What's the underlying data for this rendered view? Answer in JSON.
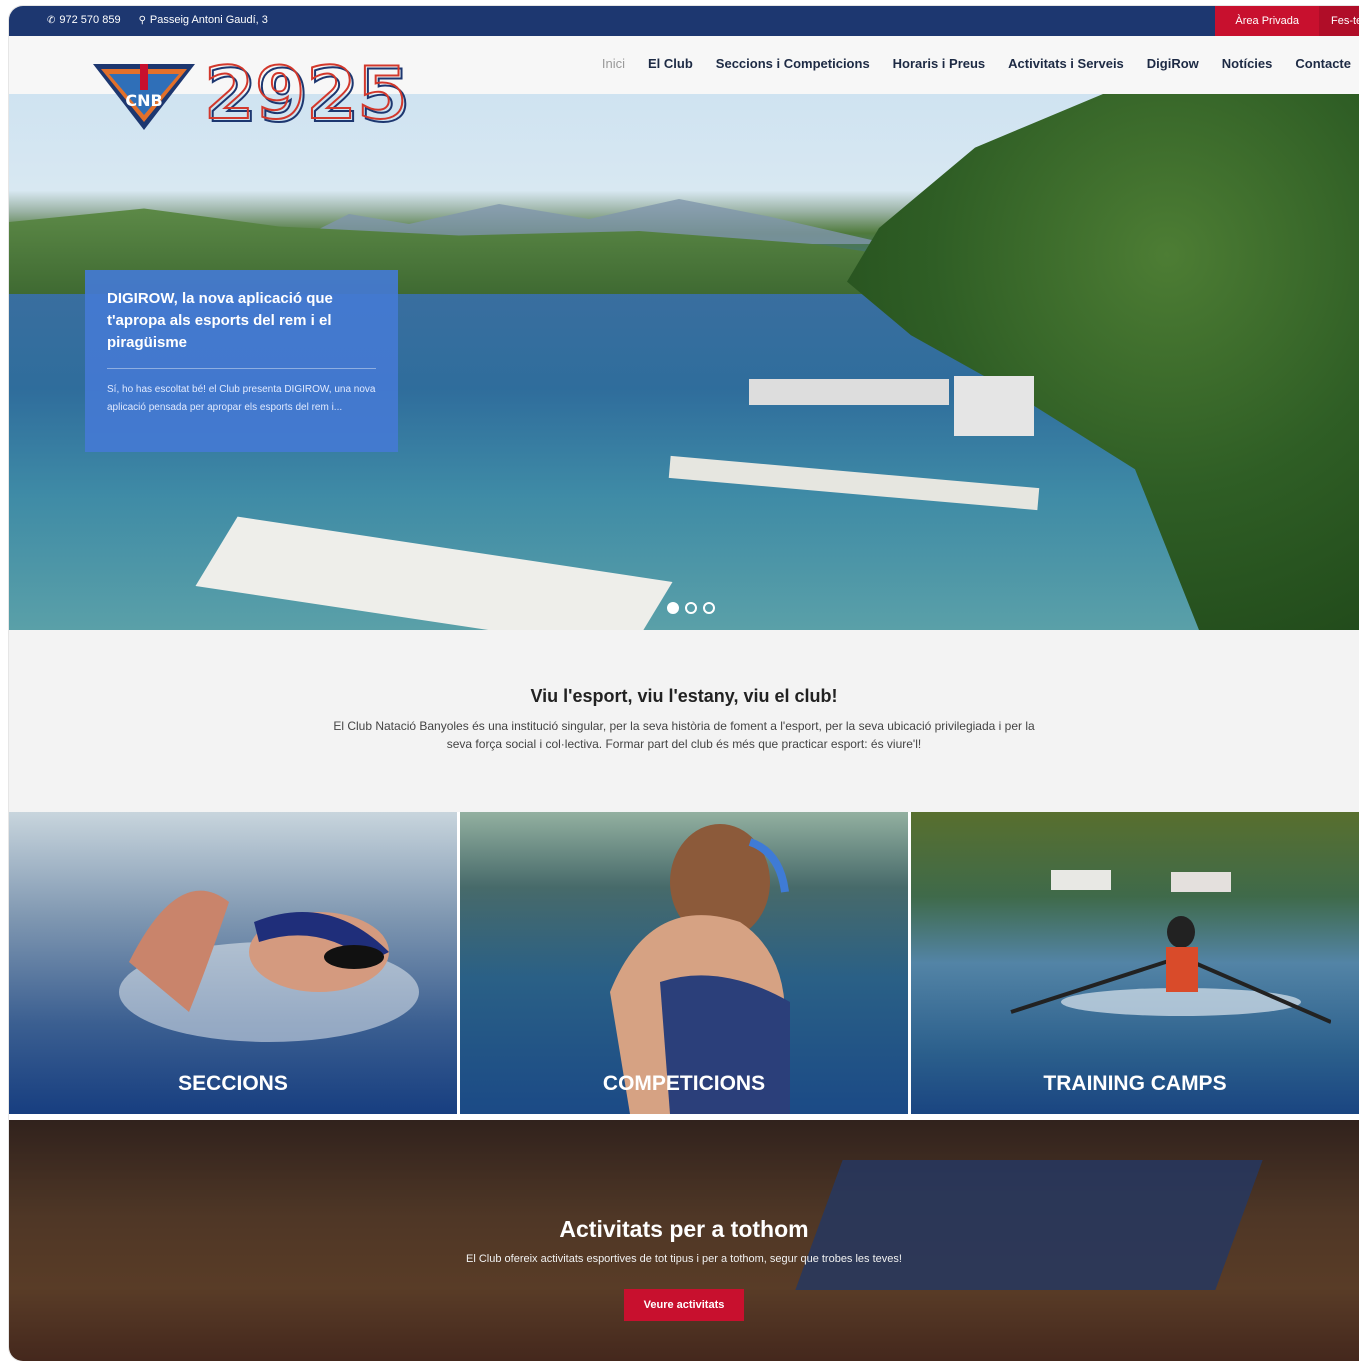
{
  "topbar": {
    "phone": "972 570 859",
    "address": "Passeig Antoni Gaudí, 3",
    "private_area": "Àrea Privada",
    "join": "Fes-te S"
  },
  "logo": {
    "badge": "CNB",
    "number": "2925"
  },
  "nav": {
    "items": [
      "Inici",
      "El Club",
      "Seccions i Competicions",
      "Horaris i Preus",
      "Activitats i Serveis",
      "DigiRow",
      "Notícies",
      "Contacte"
    ]
  },
  "hero": {
    "title": "DIGIROW, la nova aplicació que t'apropa als esports del rem i el piragüisme",
    "excerpt": "Sí, ho has escoltat bé! el Club presenta DIGIROW, una nova aplicació pensada per apropar els esports del rem i..."
  },
  "intro": {
    "heading": "Viu l'esport, viu l'estany, viu el club!",
    "text": "El Club Natació Banyoles és una institució singular, per la seva història de foment a l'esport, per la seva ubicació privilegiada i per la seva força social i col·lectiva. Formar part del club és més que practicar esport: és viure'l!"
  },
  "tiles": [
    "SECCIONS",
    "COMPETICIONS",
    "TRAINING CAMPS"
  ],
  "activities": {
    "heading": "Activitats per a tothom",
    "text": "El Club ofereix activitats esportives de tot tipus i per a tothom, segur que trobes les teves!",
    "button": "Veure activitats"
  }
}
